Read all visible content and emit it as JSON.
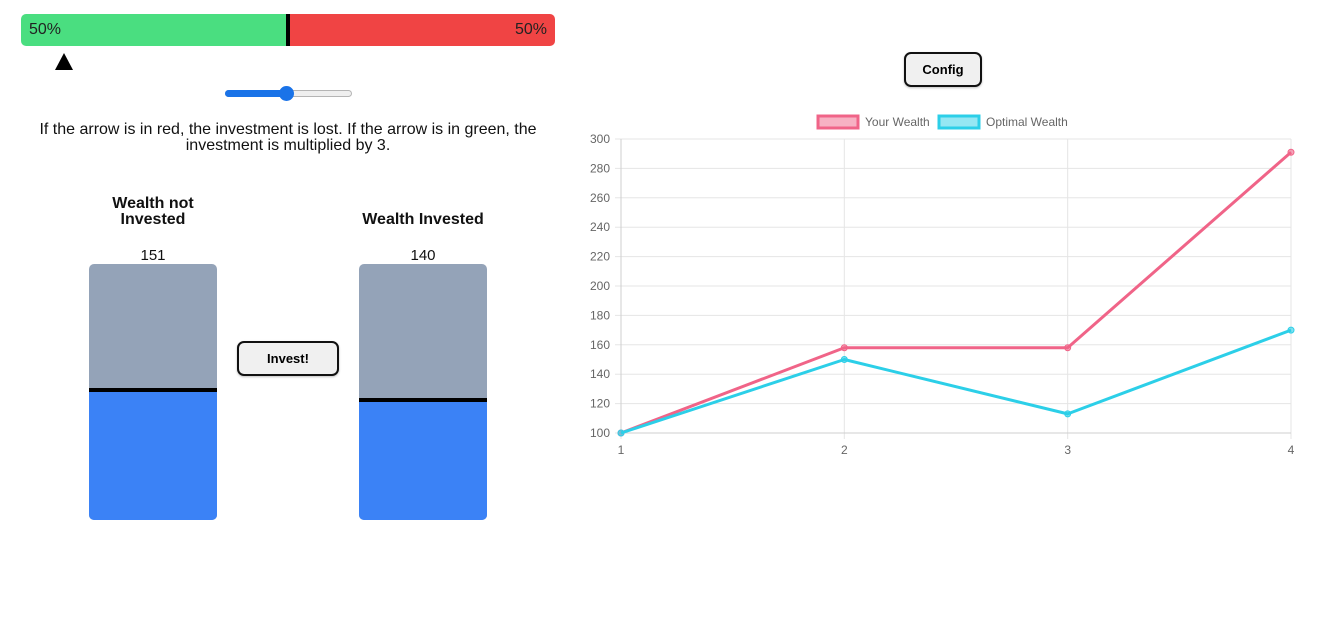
{
  "probability": {
    "green_percent_label": "50%",
    "red_percent_label": "50%",
    "green_fraction": 0.5,
    "arrow_fraction": 0.08,
    "green_color": "#4ade80",
    "red_color": "#f04444"
  },
  "slider": {
    "value_fraction": 0.48,
    "accent_color": "#1a73e8"
  },
  "rule_text": "If the arrow is in red, the investment is lost. If the arrow is in green, the investment is multiplied by 3.",
  "not_invested": {
    "title": "Wealth not Invested",
    "value": "151",
    "fill_fraction": 0.5
  },
  "invested": {
    "title": "Wealth Invested",
    "value": "140",
    "fill_fraction": 0.46
  },
  "buttons": {
    "invest_label": "Invest!",
    "config_label": "Config"
  },
  "colors": {
    "bar_empty": "#94a3b8",
    "bar_fill": "#3b82f6"
  },
  "chart_data": {
    "type": "line",
    "x": [
      1,
      2,
      3,
      4
    ],
    "series": [
      {
        "name": "Your Wealth",
        "values": [
          100,
          158,
          158,
          291
        ],
        "color": "#f06488"
      },
      {
        "name": "Optimal Wealth",
        "values": [
          100,
          150,
          113,
          170
        ],
        "color": "#2ccfe8"
      }
    ],
    "ylim": [
      100,
      300
    ],
    "yticks": [
      100,
      120,
      140,
      160,
      180,
      200,
      220,
      240,
      260,
      280,
      300
    ],
    "xticks": [
      "1",
      "2",
      "3",
      "4"
    ],
    "grid": true,
    "legend": "top-center"
  }
}
